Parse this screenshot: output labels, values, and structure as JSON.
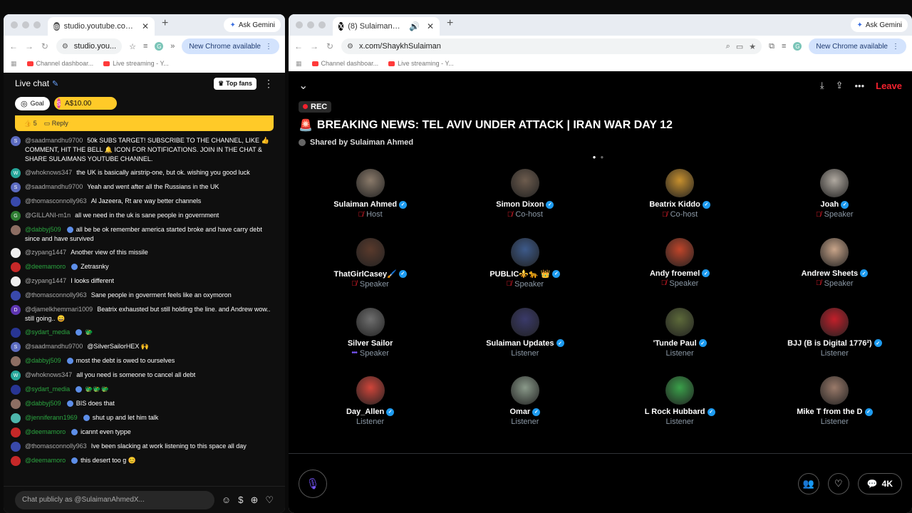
{
  "left_window": {
    "tab_title": "studio.youtube.com/live_cha",
    "new_tab": "+",
    "gemini": "Ask Gemini",
    "url": "studio.you...",
    "chrome_available": "New Chrome available",
    "bookmarks": [
      "Channel dashboar...",
      "Live streaming - Y..."
    ]
  },
  "chat": {
    "title": "Live chat",
    "top_fans": "Top fans",
    "goal": "Goal",
    "super_chat_amount": "A$10.00",
    "super_chat_avatar": "S",
    "pinned_likes": "5",
    "pinned_reply": "Reply",
    "messages": [
      {
        "author": "@saadmandhu9700",
        "text": "50k SUBS TARGET! SUBSCRIBE TO THE CHANNEL, LIKE 👍 COMMENT, HIT THE BELL 🔔 ICON FOR NOTIFICATIONS. JOIN IN THE CHAT & SHARE SULAIMANS YOUTUBE CHANNEL.",
        "initial": "S",
        "color": "#5c6bc0"
      },
      {
        "author": "@whoknows347",
        "text": "the UK is basically airstrip-one, but ok. wishing you good luck",
        "initial": "W",
        "color": "#26a69a"
      },
      {
        "author": "@saadmandhu9700",
        "text": "Yeah and went after all the Russians in the UK",
        "initial": "S",
        "color": "#5c6bc0"
      },
      {
        "author": "@thomasconnolly963",
        "text": "Al Jazeera, Rt are way better channels",
        "initial": "",
        "color": "#3949ab"
      },
      {
        "author": "@GILLANI-m1n",
        "text": "all we need in the uk is sane people in government",
        "initial": "G",
        "color": "#2e7d32"
      },
      {
        "author": "@dabbyj509",
        "text": "all be be ok remember america started broke and have carry debt since and have survived",
        "initial": "",
        "color": "#8d6e63",
        "member": true
      },
      {
        "author": "@zypang1447",
        "text": "Another view of this missile",
        "initial": "",
        "color": "#eeeeee"
      },
      {
        "author": "@deemamoro",
        "text": "Zetrasnky",
        "initial": "",
        "color": "#c62828",
        "member": true
      },
      {
        "author": "@zypang1447",
        "text": "I looks different",
        "initial": "",
        "color": "#eeeeee"
      },
      {
        "author": "@thomasconnolly963",
        "text": "Sane people in goverment feels like an oxymoron",
        "initial": "",
        "color": "#3949ab"
      },
      {
        "author": "@djamelkhemmari1009",
        "text": "Beatrix exhausted but still holding the line. and Andrew wow.. still going.. 😄",
        "initial": "D",
        "color": "#5e35b1"
      },
      {
        "author": "@sydart_media",
        "text": "🐲",
        "initial": "",
        "color": "#283593",
        "member": true
      },
      {
        "author": "@saadmandhu9700",
        "text": "@SilverSailorHEX 🙌",
        "initial": "S",
        "color": "#5c6bc0"
      },
      {
        "author": "@dabbyj509",
        "text": "most the debt is owed to ourselves",
        "initial": "",
        "color": "#8d6e63",
        "member": true
      },
      {
        "author": "@whoknows347",
        "text": "all you need is someone to cancel all debt",
        "initial": "W",
        "color": "#26a69a"
      },
      {
        "author": "@sydart_media",
        "text": "🐲🐲🐲",
        "initial": "",
        "color": "#283593",
        "member": true
      },
      {
        "author": "@dabbyj509",
        "text": "BIS does that",
        "initial": "",
        "color": "#8d6e63",
        "member": true
      },
      {
        "author": "@jenniferann1969",
        "text": "shut up and let him talk",
        "initial": "",
        "color": "#4db6ac",
        "member": true
      },
      {
        "author": "@deemamoro",
        "text": "icannt even typpe",
        "initial": "",
        "color": "#c62828",
        "member": true
      },
      {
        "author": "@thomasconnolly963",
        "text": "Ive been slacking at work listening to this space all day",
        "initial": "",
        "color": "#3949ab"
      },
      {
        "author": "@deemamoro",
        "text": "this desert too g 😊",
        "initial": "",
        "color": "#c62828",
        "member": true
      }
    ],
    "input_placeholder": "Chat publicly as @SulaimanAhmedX..."
  },
  "right_window": {
    "tab_title": "(8) Sulaiman Ahmed (@Sh",
    "new_tab": "+",
    "gemini": "Ask Gemini",
    "url": "x.com/ShaykhSulaiman",
    "chrome_available": "New Chrome available",
    "bookmarks": [
      "Channel dashboar...",
      "Live streaming - Y..."
    ]
  },
  "space": {
    "leave": "Leave",
    "rec": "REC",
    "title": "BREAKING NEWS: TEL AVIV UNDER ATTACK | IRAN WAR DAY 12",
    "shared_by": "Shared by Sulaiman Ahmed",
    "participants": [
      {
        "name": "Sulaiman Ahmed",
        "role": "Host",
        "verified": true,
        "muted": true,
        "color": "#8a7a6a"
      },
      {
        "name": "Simon Dixon",
        "role": "Co-host",
        "verified": true,
        "muted": true,
        "color": "#6d5c4e"
      },
      {
        "name": "Beatrix Kiddo",
        "role": "Co-host",
        "verified": true,
        "muted": true,
        "color": "#c7902e"
      },
      {
        "name": "Joah",
        "role": "Speaker",
        "verified": true,
        "muted": true,
        "color": "#b0a9a0"
      },
      {
        "name": "ThatGirlCasey🖌️",
        "role": "Speaker",
        "verified": true,
        "muted": true,
        "color": "#5a3a2c"
      },
      {
        "name": "PUBLIC⚜️🐆 👑",
        "role": "Speaker",
        "verified": true,
        "muted": true,
        "color": "#3d5a8a"
      },
      {
        "name": "Andy froemel",
        "role": "Speaker",
        "verified": true,
        "muted": true,
        "color": "#c0452a"
      },
      {
        "name": "Andrew Sheets",
        "role": "Speaker",
        "verified": true,
        "muted": true,
        "color": "#c9a58a"
      },
      {
        "name": "Silver Sailor",
        "role": "Speaker",
        "verified": false,
        "muted": false,
        "color": "#6f6f6f"
      },
      {
        "name": "Sulaiman Updates",
        "role": "Listener",
        "verified": true,
        "muted": false,
        "color": "#3a3a6a"
      },
      {
        "name": "'Tunde Paul",
        "role": "Listener",
        "verified": true,
        "muted": false,
        "color": "#5d6a3a"
      },
      {
        "name": "BJJ (B is Digital 1776²)",
        "role": "Listener",
        "verified": true,
        "muted": false,
        "color": "#c21f2a"
      },
      {
        "name": "Day_Allen",
        "role": "Listener",
        "verified": true,
        "muted": false,
        "color": "#d0453a"
      },
      {
        "name": "Omar",
        "role": "Listener",
        "verified": true,
        "muted": false,
        "color": "#8a9a8a"
      },
      {
        "name": "L Rock Hubbard",
        "role": "Listener",
        "verified": true,
        "muted": false,
        "color": "#3aa04a"
      },
      {
        "name": "Mike T from the D",
        "role": "Listener",
        "verified": true,
        "muted": false,
        "color": "#9a7a6a"
      }
    ],
    "reply_count": "4K"
  },
  "icons": {
    "accent_red": "#f4212e",
    "verified_blue": "#1d9bf0",
    "space_purple": "#7856ff",
    "yt_yellow": "#ffca28"
  }
}
